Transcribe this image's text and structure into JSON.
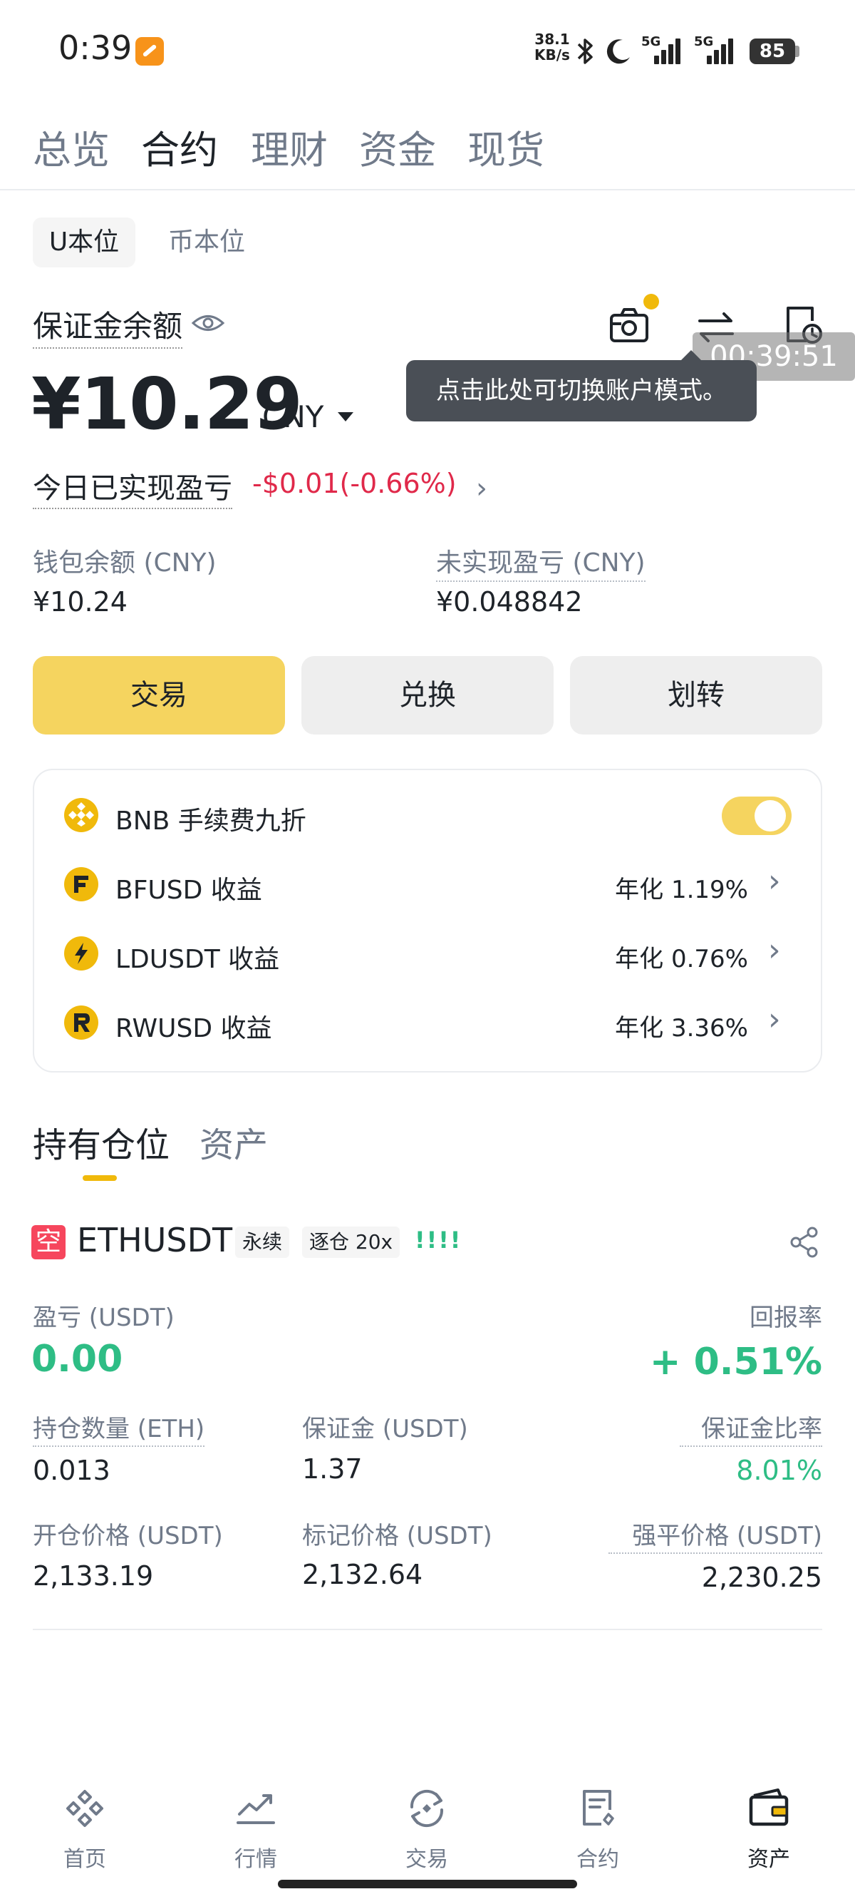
{
  "status_bar": {
    "time": "0:39",
    "net_speed_value": "38.1",
    "net_speed_unit": "KB/s",
    "sim1": "5G",
    "sim2": "5G",
    "battery": "85"
  },
  "top_tabs": [
    "总览",
    "合约",
    "理财",
    "资金",
    "现货"
  ],
  "top_tabs_active": 1,
  "margin_type": {
    "active": "U本位",
    "inactive": "币本位"
  },
  "balance": {
    "label": "保证金余额",
    "amount": "¥10.29",
    "currency": "CNY",
    "today_pnl_label": "今日已实现盈亏",
    "today_pnl_value": "-$0.01(-0.66%)",
    "wallet_label": "钱包余额 (CNY)",
    "wallet_value": "¥10.24",
    "unrealized_label": "未实现盈亏 (CNY)",
    "unrealized_value": "¥0.048842"
  },
  "tooltip": "点击此处可切换账户模式。",
  "timer": "00:39:51",
  "actions": {
    "trade": "交易",
    "convert": "兑换",
    "transfer": "划转"
  },
  "earn_card": {
    "bnb_label": "BNB 手续费九折",
    "bnb_toggle_on": true,
    "rows": [
      {
        "label": "BFUSD 收益",
        "rate": "年化 1.19%",
        "icon": "bfusd-icon"
      },
      {
        "label": "LDUSDT 收益",
        "rate": "年化 0.76%",
        "icon": "ldusdt-icon"
      },
      {
        "label": "RWUSD 收益",
        "rate": "年化 3.36%",
        "icon": "rwusd-icon"
      }
    ]
  },
  "section_tabs": [
    "持有仓位",
    "资产"
  ],
  "position": {
    "side_badge": "空",
    "symbol": "ETHUSDT",
    "tag_perpetual": "永续",
    "tag_margin": "逐仓 20x",
    "signal": "!!!!",
    "pnl_label": "盈亏 (USDT)",
    "pnl_value": "0.00",
    "roe_label": "回报率",
    "roe_value": "+ 0.51%",
    "size_label": "持仓数量 (ETH)",
    "size_value": "0.013",
    "margin_label": "保证金 (USDT)",
    "margin_value": "1.37",
    "margin_ratio_label": "保证金比率",
    "margin_ratio_value": "8.01%",
    "entry_label": "开仓价格 (USDT)",
    "entry_value": "2,133.19",
    "mark_label": "标记价格 (USDT)",
    "mark_value": "2,132.64",
    "liq_label": "强平价格 (USDT)",
    "liq_value": "2,230.25"
  },
  "bottom_nav": [
    {
      "label": "首页",
      "icon": "binance-logo-icon"
    },
    {
      "label": "行情",
      "icon": "chart-icon"
    },
    {
      "label": "交易",
      "icon": "trade-icon"
    },
    {
      "label": "合约",
      "icon": "futures-icon"
    },
    {
      "label": "资产",
      "icon": "wallet-icon"
    }
  ],
  "bottom_nav_active": 4,
  "colors": {
    "accent": "#f0b90b",
    "button_primary": "#f5d45f",
    "negative": "#e0294a",
    "positive": "#2ebd85"
  }
}
